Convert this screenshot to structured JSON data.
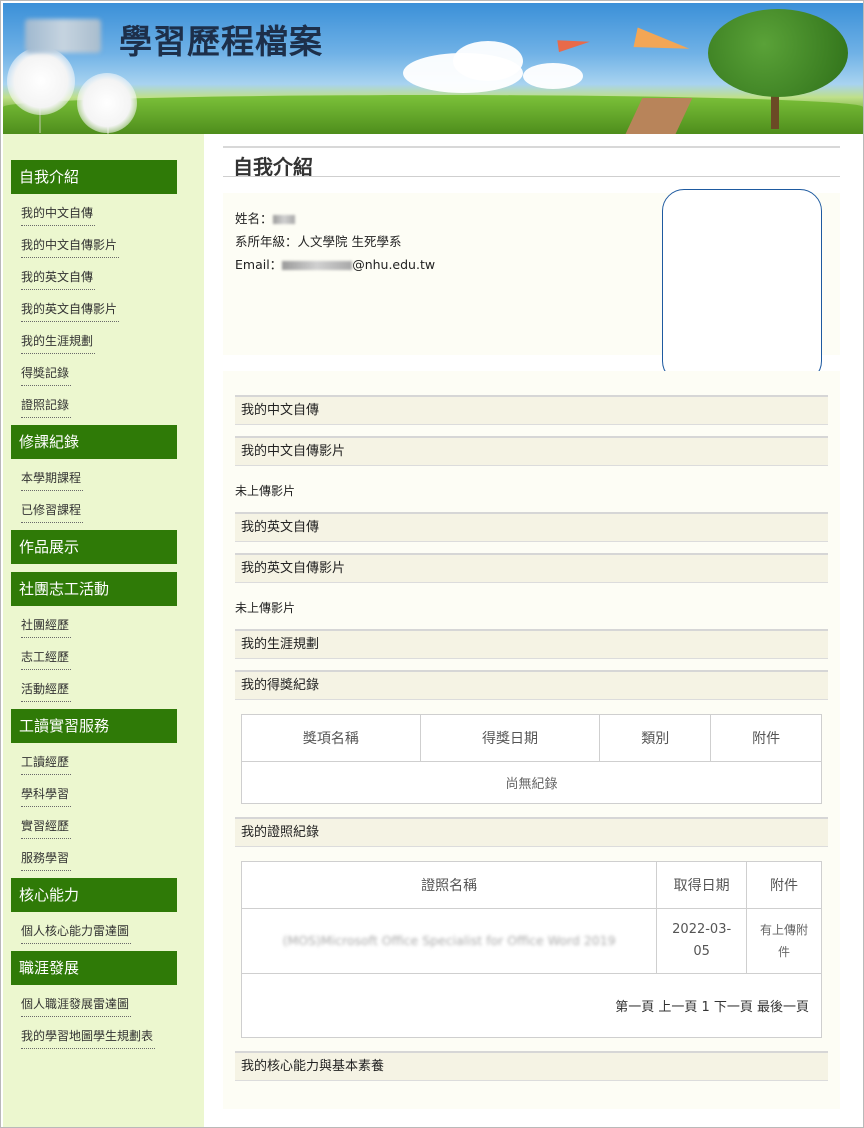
{
  "banner": {
    "title": "學習歷程檔案"
  },
  "sidebar": {
    "sections": [
      {
        "label": "自我介紹",
        "items": [
          "我的中文自傳",
          "我的中文自傳影片",
          "我的英文自傳",
          "我的英文自傳影片",
          "我的生涯規劃",
          "得獎記錄",
          "證照記錄"
        ]
      },
      {
        "label": "修課紀錄",
        "items": [
          "本學期課程",
          "已修習課程"
        ]
      },
      {
        "label": "作品展示",
        "items": []
      },
      {
        "label": "社團志工活動",
        "items": [
          "社團經歷",
          "志工經歷",
          "活動經歷"
        ]
      },
      {
        "label": "工讀實習服務",
        "items": [
          "工讀經歷",
          "學科學習",
          "實習經歷",
          "服務學習"
        ]
      },
      {
        "label": "核心能力",
        "items": [
          "個人核心能力雷達圖"
        ]
      },
      {
        "label": "職涯發展",
        "items": [
          "個人職涯發展雷達圖",
          "我的學習地圖學生規劃表"
        ]
      }
    ]
  },
  "main": {
    "title": "自我介紹",
    "profile": {
      "name_label": "姓名：",
      "dept_label": "系所年級：",
      "dept_value": "人文學院 生死學系",
      "email_label": "Email：",
      "email_domain": "@nhu.edu.tw"
    },
    "sections": {
      "cn_bio": "我的中文自傳",
      "cn_video": "我的中文自傳影片",
      "cn_video_note": "未上傳影片",
      "en_bio": "我的英文自傳",
      "en_video": "我的英文自傳影片",
      "en_video_note": "未上傳影片",
      "career": "我的生涯規劃",
      "awards": "我的得獎紀錄",
      "certs": "我的證照紀錄",
      "core": "我的核心能力與基本素養"
    },
    "awards_table": {
      "headers": [
        "獎項名稱",
        "得獎日期",
        "類別",
        "附件"
      ],
      "empty": "尚無紀錄"
    },
    "certs_table": {
      "headers": [
        "證照名稱",
        "取得日期",
        "附件"
      ],
      "rows": [
        {
          "name": "(MOS)Microsoft Office Specialist for Office Word 2019",
          "date": "2022-03-05",
          "attachment": "有上傳附件"
        }
      ],
      "pager": "第一頁 上一頁 1 下一頁 最後一頁"
    }
  }
}
